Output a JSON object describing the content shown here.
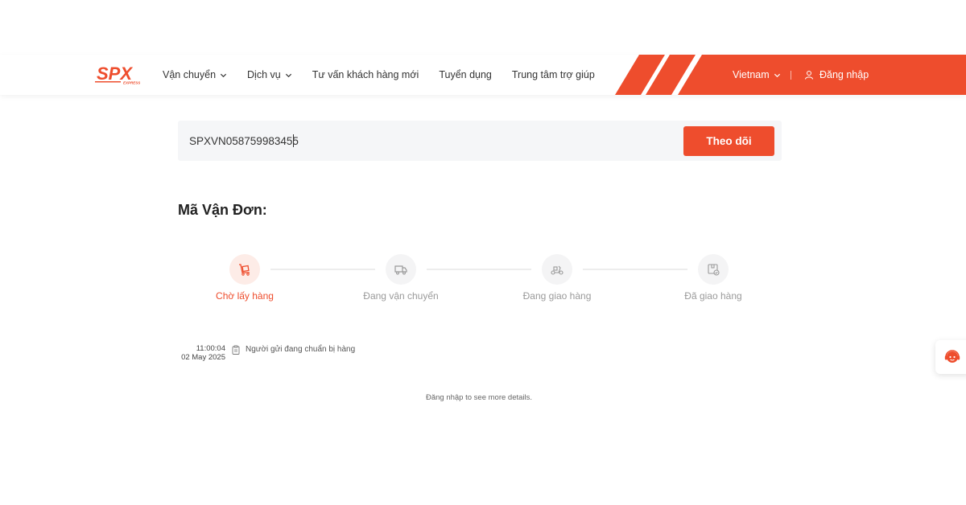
{
  "brand": {
    "logo_text": "SPX",
    "logo_subtext": "EXPRESS",
    "accent": "#ee4d2d"
  },
  "nav": {
    "items": [
      {
        "label": "Vận chuyển",
        "dropdown": true
      },
      {
        "label": "Dịch vụ",
        "dropdown": true
      },
      {
        "label": "Tư vấn khách hàng mới",
        "dropdown": false
      },
      {
        "label": "Tuyển dụng",
        "dropdown": false
      },
      {
        "label": "Trung tâm trợ giúp",
        "dropdown": false
      }
    ],
    "language": "Vietnam",
    "login_label": "Đăng nhập"
  },
  "search": {
    "value": "SPXVN058759983455",
    "button_label": "Theo dõi"
  },
  "section_title": "Mã Vận Đơn:",
  "steps": [
    {
      "label": "Chờ lấy hàng",
      "icon": "pallet-icon",
      "active": true
    },
    {
      "label": "Đang vận chuyển",
      "icon": "truck-icon",
      "active": false
    },
    {
      "label": "Đang giao hàng",
      "icon": "scooter-icon",
      "active": false
    },
    {
      "label": "Đã giao hàng",
      "icon": "delivered-box-icon",
      "active": false
    }
  ],
  "timeline": [
    {
      "time": "11:00:04",
      "date": "02 May 2025",
      "icon": "clipboard-icon",
      "text": "Người gửi đang chuẩn bị hàng"
    }
  ],
  "more_details": {
    "link": "Đăng nhập",
    "text": " to see more details."
  },
  "support": {
    "icon": "customer-support-icon"
  }
}
